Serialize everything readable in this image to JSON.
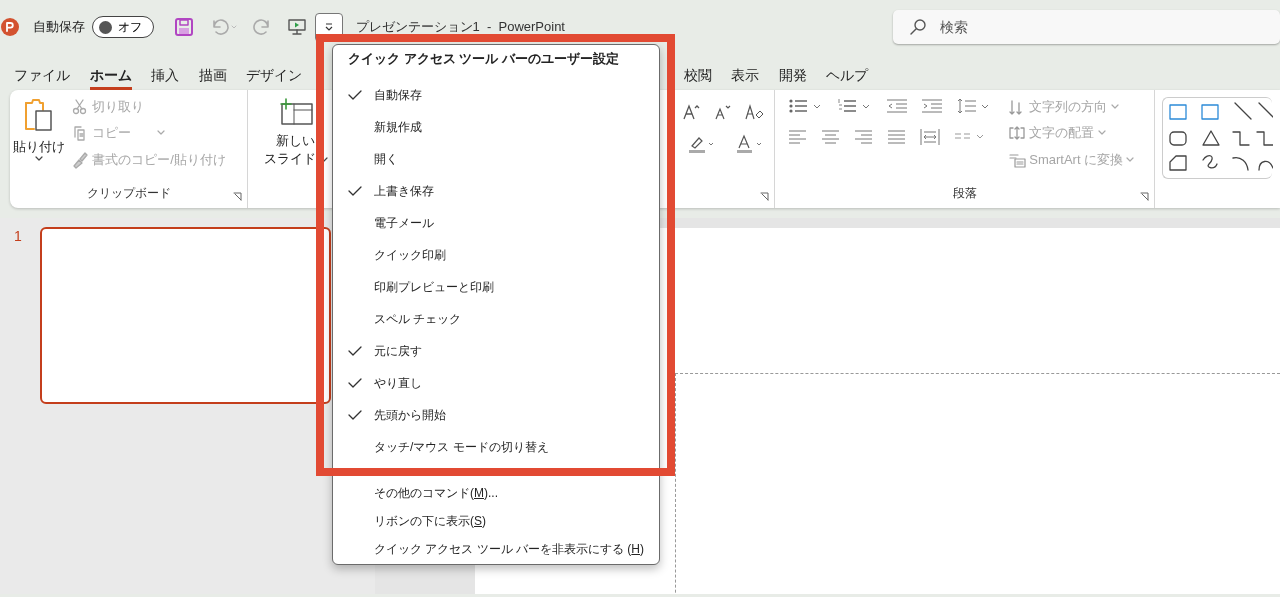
{
  "title_bar": {
    "autosave_label": "自動保存",
    "autosave_toggle": {
      "label": "オフ",
      "on": false
    },
    "customize_menu_open": true,
    "document_title": "プレゼンテーション1  -  PowerPoint",
    "search": {
      "placeholder": "検索"
    }
  },
  "tabs": [
    {
      "label": "ファイル",
      "selected": false
    },
    {
      "label": "ホーム",
      "selected": true
    },
    {
      "label": "挿入",
      "selected": false
    },
    {
      "label": "描画",
      "selected": false
    },
    {
      "label": "デザイン",
      "selected": false
    },
    {
      "label": "校閲",
      "selected": false
    },
    {
      "label": "表示",
      "selected": false
    },
    {
      "label": "開発",
      "selected": false
    },
    {
      "label": "ヘルプ",
      "selected": false
    }
  ],
  "ribbon": {
    "clipboard": {
      "paste": {
        "label": "貼り付け"
      },
      "commands": [
        {
          "label": "切り取り",
          "disabled": true,
          "dropdown": false
        },
        {
          "label": "コピー",
          "disabled": true,
          "dropdown": true
        },
        {
          "label": "書式のコピー/貼り付け",
          "disabled": true,
          "dropdown": false
        }
      ],
      "group_label": "クリップボード"
    },
    "slides": {
      "new_slide": {
        "label_line1": "新しい",
        "label_line2": "スライド"
      }
    },
    "paragraph": {
      "commands": [
        {
          "label": "文字列の方向",
          "disabled": true
        },
        {
          "label": "文字の配置",
          "disabled": true
        },
        {
          "label": "SmartArt に変換",
          "disabled": true
        }
      ],
      "group_label": "段落"
    }
  },
  "slides_pane": [
    {
      "number": "1",
      "selected": true
    }
  ],
  "qat_menu": {
    "title": "クイック アクセス ツール バーのユーザー設定",
    "items": [
      {
        "label": "自動保存",
        "checked": true
      },
      {
        "label": "新規作成",
        "checked": false
      },
      {
        "label": "開く",
        "checked": false
      },
      {
        "label": "上書き保存",
        "checked": true
      },
      {
        "label": "電子メール",
        "checked": false
      },
      {
        "label": "クイック印刷",
        "checked": false
      },
      {
        "label": "印刷プレビューと印刷",
        "checked": false
      },
      {
        "label": "スペル チェック",
        "checked": false
      },
      {
        "label": "元に戻す",
        "checked": true
      },
      {
        "label": "やり直し",
        "checked": true
      },
      {
        "label": "先頭から開始",
        "checked": true
      },
      {
        "label": "タッチ/マウス モードの切り替え",
        "checked": false
      }
    ],
    "commands": [
      {
        "before": "その他のコマンド(",
        "access_key": "M",
        "after": ")..."
      },
      {
        "before": "リボンの下に表示(",
        "access_key": "S",
        "after": ")"
      },
      {
        "before": "クイック アクセス ツール バーを非表示にする (",
        "access_key": "H",
        "after": ")"
      }
    ]
  }
}
